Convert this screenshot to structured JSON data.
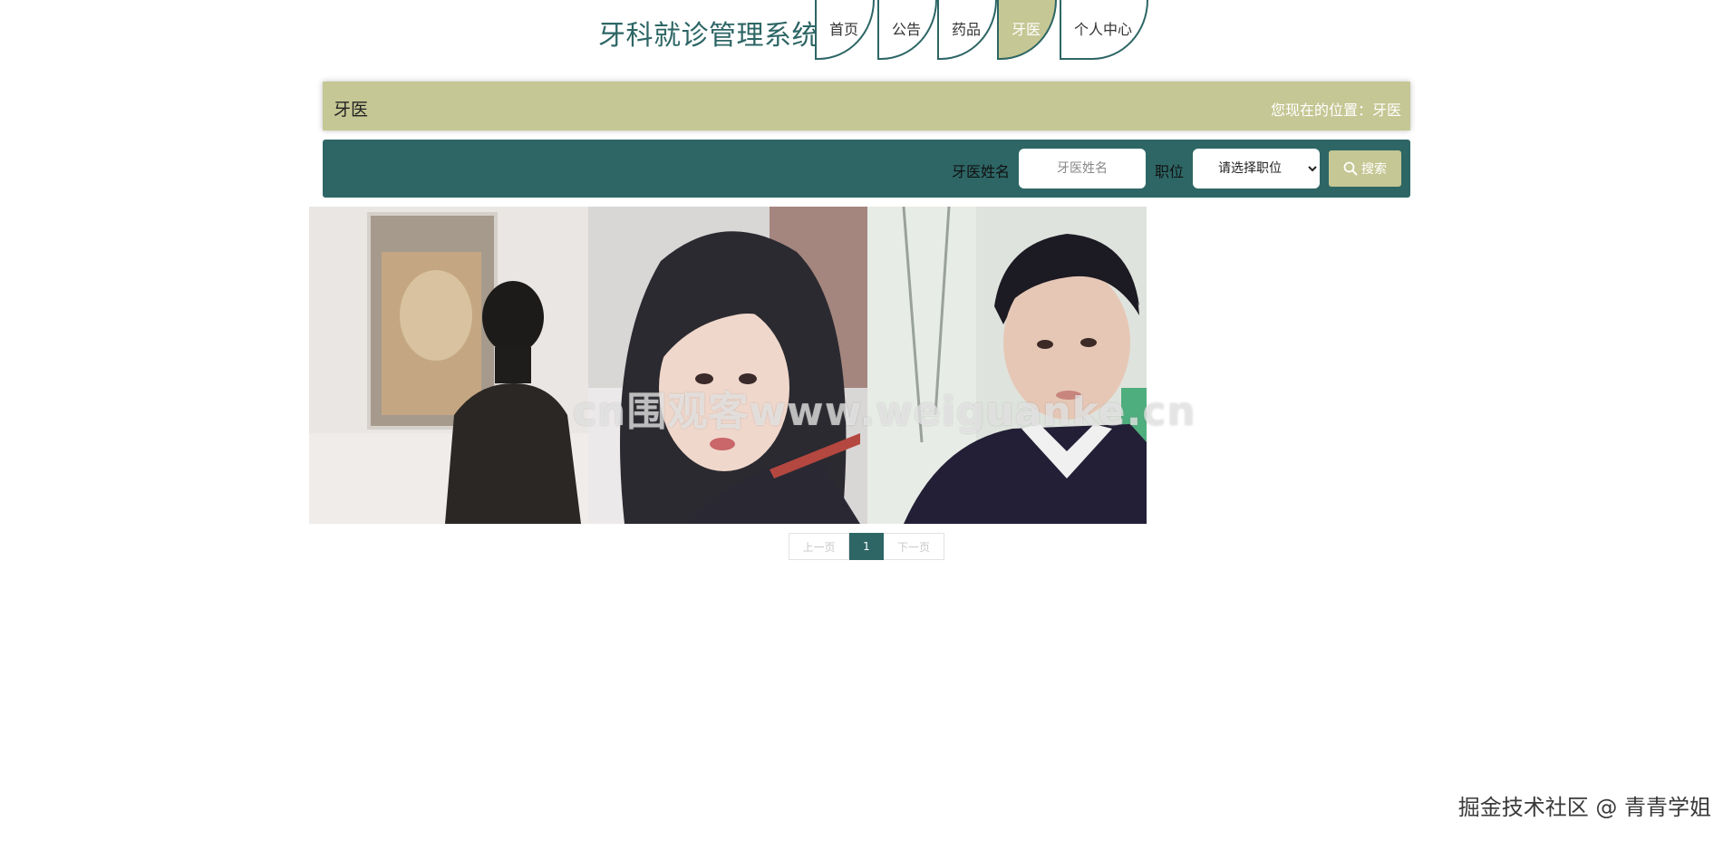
{
  "header": {
    "site_title": "牙科就诊管理系统",
    "nav": [
      {
        "label": "首页",
        "active": false
      },
      {
        "label": "公告",
        "active": false
      },
      {
        "label": "药品",
        "active": false
      },
      {
        "label": "牙医",
        "active": true
      },
      {
        "label": "个人中心",
        "active": false
      }
    ]
  },
  "breadcrumb": {
    "title": "牙医",
    "location": "您现在的位置：牙医"
  },
  "search": {
    "name_label": "牙医姓名",
    "name_placeholder": "牙医姓名",
    "name_value": "",
    "position_label": "职位",
    "position_selected": "请选择职位",
    "button_label": "搜索"
  },
  "doctors": [
    {
      "photo": "doctor-photo-1"
    },
    {
      "photo": "doctor-photo-2"
    },
    {
      "photo": "doctor-photo-3"
    }
  ],
  "watermark": "cn围观客www.weiguanke.cn",
  "pagination": {
    "prev_label": "上一页",
    "current_page": "1",
    "next_label": "下一页"
  },
  "credit": "掘金技术社区 @ 青青学姐",
  "colors": {
    "primary": "#2d6665",
    "accent": "#c5c794"
  }
}
